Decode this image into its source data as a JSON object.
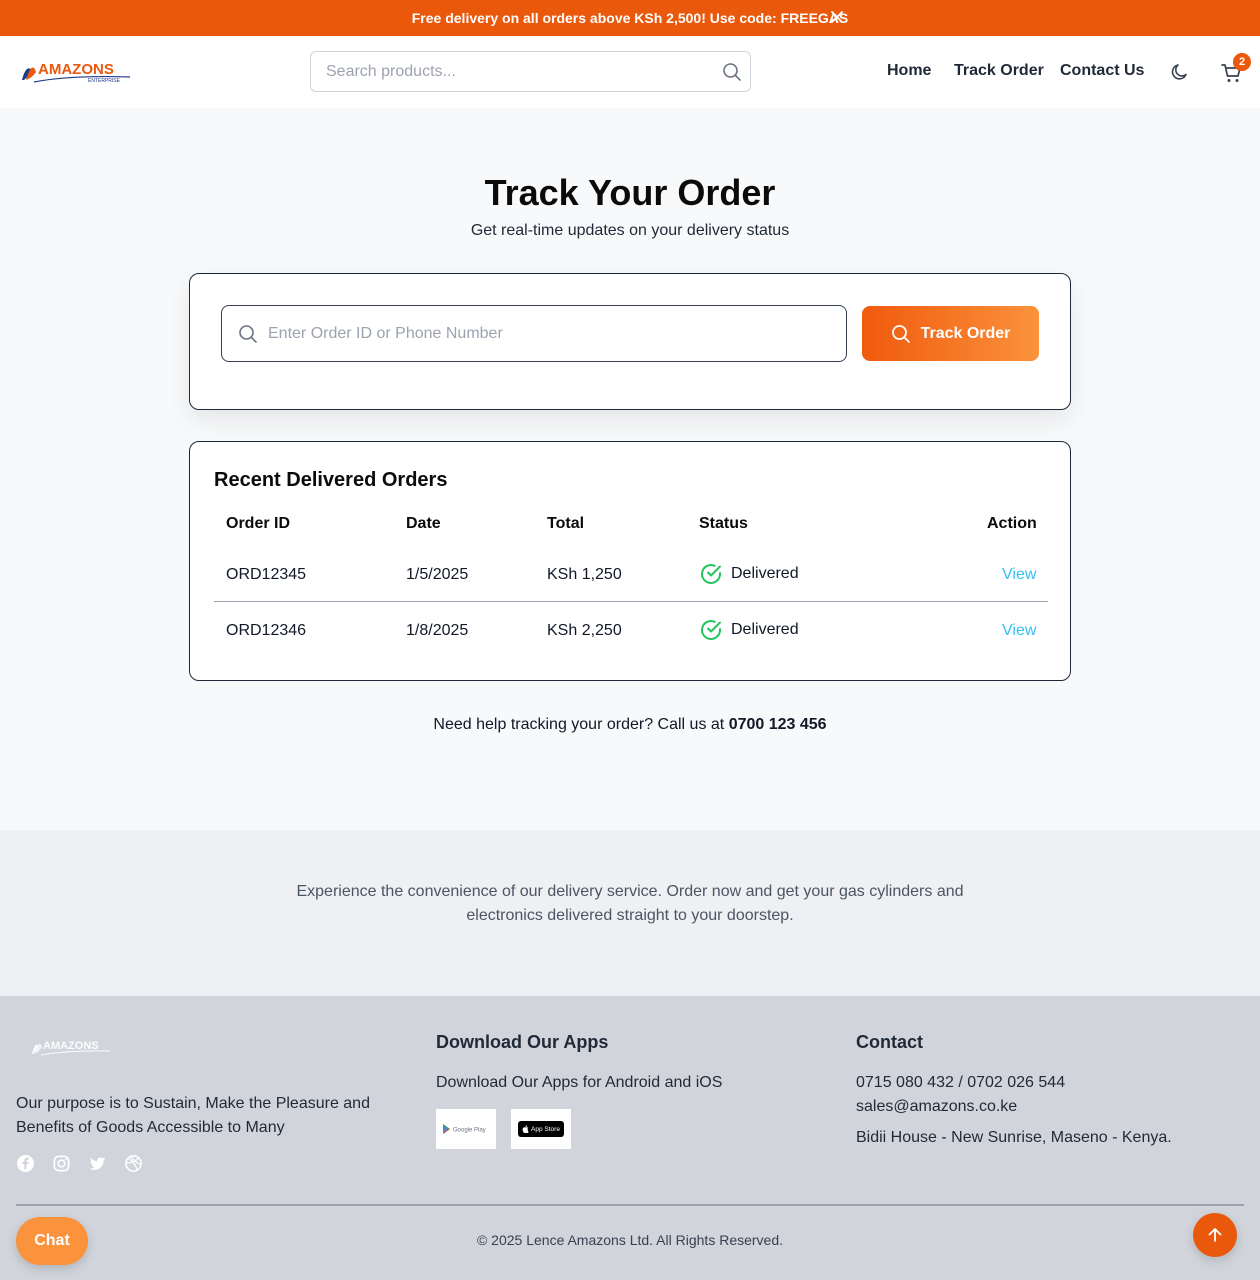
{
  "promo": {
    "text": "Free delivery on all orders above KSh 2,500! Use code: FREEGAS"
  },
  "header": {
    "search_placeholder": "Search products...",
    "nav": [
      "Home",
      "Track Order",
      "Contact Us"
    ],
    "cart_count": "2"
  },
  "brand": {
    "name": "AMAZONS",
    "tagline": "ENTERPRISE"
  },
  "main": {
    "title": "Track Your Order",
    "subtitle": "Get real-time updates on your delivery status",
    "track_placeholder": "Enter Order ID or Phone Number",
    "track_button": "Track Order"
  },
  "orders": {
    "title": "Recent Delivered Orders",
    "columns": [
      "Order ID",
      "Date",
      "Total",
      "Status",
      "Action"
    ],
    "rows": [
      {
        "id": "ORD12345",
        "date": "1/5/2025",
        "total": "KSh 1,250",
        "status": "Delivered",
        "action": "View"
      },
      {
        "id": "ORD12346",
        "date": "1/8/2025",
        "total": "KSh 2,250",
        "status": "Delivered",
        "action": "View"
      }
    ]
  },
  "help": {
    "text": "Need help tracking your order? Call us at ",
    "phone": "0700 123 456"
  },
  "promo_section": {
    "text": "Experience the convenience of our delivery service. Order now and get your gas cylinders and electronics delivered straight to your doorstep."
  },
  "footer": {
    "purpose": "Our purpose is to Sustain, Make the Pleasure and Benefits of Goods Accessible to Many",
    "apps_heading": "Download Our Apps",
    "apps_text": "Download Our Apps for Android and iOS",
    "google_play": "Google Play",
    "app_store": "App Store",
    "contact_heading": "Contact",
    "phones": "0715 080 432 / 0702 026 544",
    "email": "sales@amazons.co.ke",
    "address": "Bidii House - New Sunrise, Maseno - Kenya.",
    "copyright": "© 2025 Lence Amazons Ltd. All Rights Reserved."
  },
  "chat": {
    "label": "Chat"
  },
  "colors": {
    "accent": "#ea580c",
    "accent_light": "#fb923c",
    "success": "#22c55e",
    "link": "#38bdf8"
  },
  "icons": [
    "close-icon",
    "search-icon",
    "moon-icon",
    "cart-icon",
    "check-circle-icon",
    "facebook-icon",
    "instagram-icon",
    "twitter-icon",
    "dribbble-icon",
    "arrow-up-icon"
  ]
}
